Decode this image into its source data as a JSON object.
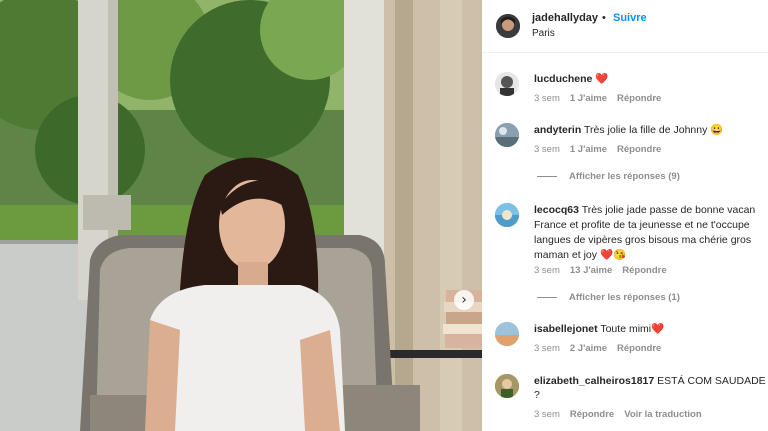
{
  "post": {
    "username": "jadehallyday",
    "separator": "•",
    "follow_label": "Suivre",
    "location": "Paris",
    "next_icon": "chevron-right-icon"
  },
  "comments": [
    {
      "user": "lucduchene",
      "text": "",
      "emoji": "❤️",
      "time": "3 sem",
      "likes": "1 J'aime",
      "reply": "Répondre"
    },
    {
      "user": "andyterin",
      "text": "Très jolie la fille de Johnny",
      "emoji": "😀",
      "time": "3 sem",
      "likes": "1 J'aime",
      "reply": "Répondre",
      "replies_label": "Afficher les réponses (9)"
    },
    {
      "user": "lecocq63",
      "lines": [
        "Très jolie jade passe de bonne vacan",
        "France et profite de ta jeunesse et ne t'occupe",
        "langues de vipères gros bisous ma chérie gros",
        "maman et joy"
      ],
      "emoji": "❤️😘",
      "time": "3 sem",
      "likes": "13 J'aime",
      "reply": "Répondre",
      "replies_label": "Afficher les réponses (1)"
    },
    {
      "user": "isabellejonet",
      "text": "Toute mimi",
      "emoji": "❤️",
      "time": "3 sem",
      "likes": "2 J'aime",
      "reply": "Répondre"
    },
    {
      "user": "elizabeth_calheiros1817",
      "text": "ESTÁ COM SAUDADE",
      "line2": "?",
      "time": "3 sem",
      "reply": "Répondre",
      "translate": "Voir la traduction"
    }
  ],
  "colors": {
    "accent": "#0095f6",
    "text": "#262626",
    "muted": "#8e8e8e"
  }
}
